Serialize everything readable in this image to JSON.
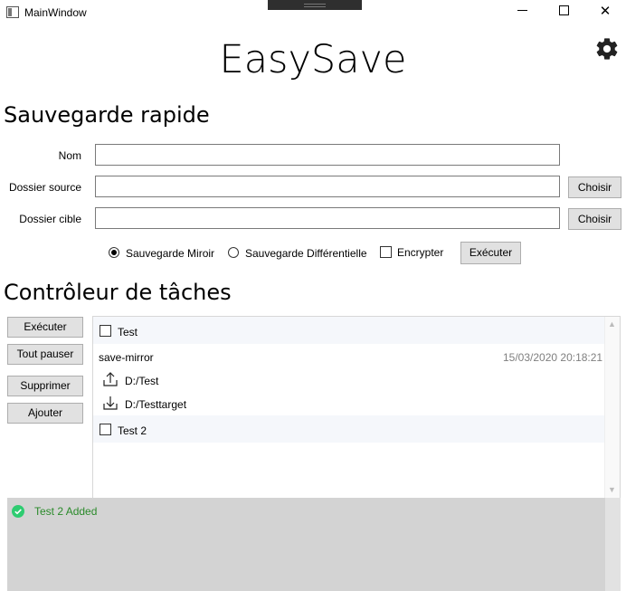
{
  "window": {
    "title": "MainWindow",
    "minimize": "—",
    "maximize": "□",
    "close": "✕"
  },
  "app": {
    "title": "EasySave",
    "settings_icon": "gear-icon"
  },
  "quick_save": {
    "heading": "Sauvegarde rapide",
    "name_label": "Nom",
    "name_value": "",
    "source_label": "Dossier source",
    "source_value": "",
    "target_label": "Dossier cible",
    "target_value": "",
    "choose_label": "Choisir",
    "mirror_label": "Sauvegarde Miroir",
    "mirror_selected": true,
    "differential_label": "Sauvegarde Différentielle",
    "differential_selected": false,
    "encrypt_label": "Encrypter",
    "encrypt_checked": false,
    "execute_label": "Exécuter"
  },
  "task_controller": {
    "heading": "Contrôleur de tâches",
    "buttons": {
      "execute": "Exécuter",
      "pause_all": "Tout pauser",
      "delete": "Supprimer",
      "add": "Ajouter"
    },
    "tasks": [
      {
        "name": "Test",
        "checked": false,
        "expanded": false
      },
      {
        "name": "save-mirror",
        "expanded": true,
        "date": "15/03/2020 20:18:21",
        "source": "D:/Test",
        "target": "D:/Testtarget",
        "source_icon": "upload-icon",
        "target_icon": "download-icon"
      },
      {
        "name": "Test 2",
        "checked": false,
        "expanded": false
      }
    ]
  },
  "status": {
    "message": "Test 2 Added",
    "icon": "check-circle-icon",
    "color": "#2a8a2a"
  },
  "colors": {
    "button_bg": "#e1e1e1",
    "status_bg": "#d3d3d3",
    "alt_row": "#f5f7fb",
    "success": "#2ecc71"
  }
}
